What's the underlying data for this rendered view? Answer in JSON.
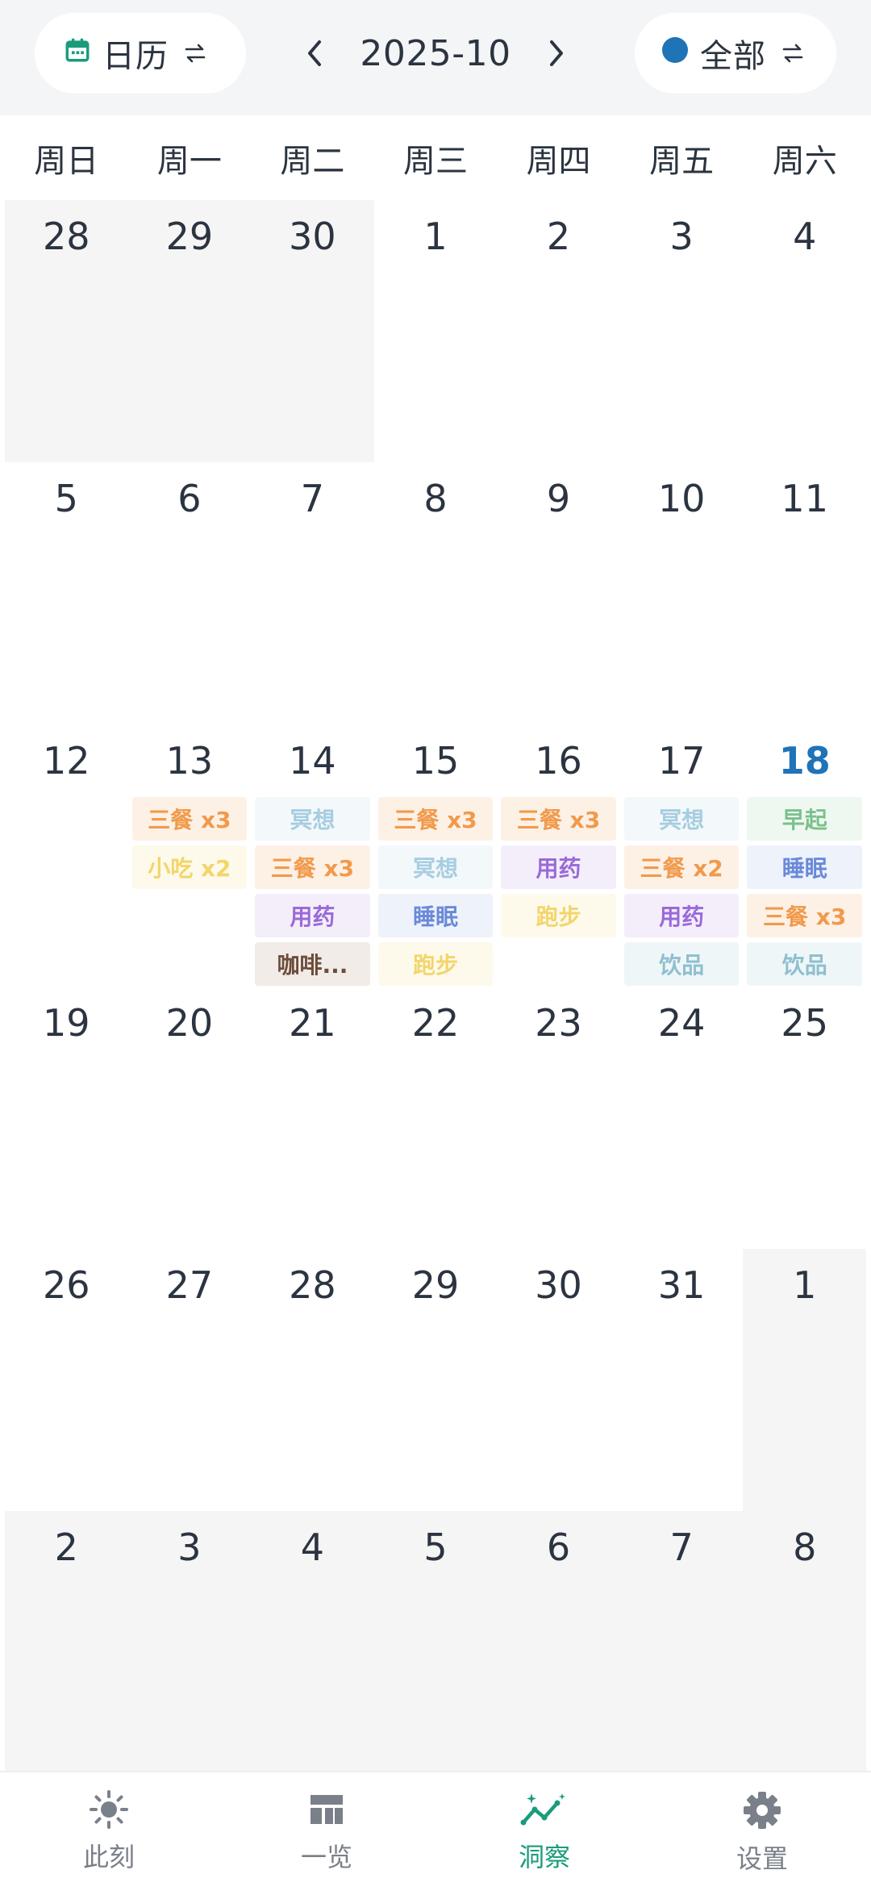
{
  "header": {
    "view_label": "日历",
    "month_label": "2025-10",
    "filter_label": "全部",
    "filter_color": "#1f73b7",
    "view_icon_color": "#1a9c7b"
  },
  "weekdays": [
    "周日",
    "周一",
    "周二",
    "周三",
    "周四",
    "周五",
    "周六"
  ],
  "weeks": [
    [
      {
        "day": "28",
        "out": true
      },
      {
        "day": "29",
        "out": true
      },
      {
        "day": "30",
        "out": true
      },
      {
        "day": "1"
      },
      {
        "day": "2"
      },
      {
        "day": "3"
      },
      {
        "day": "4"
      }
    ],
    [
      {
        "day": "5"
      },
      {
        "day": "6"
      },
      {
        "day": "7"
      },
      {
        "day": "8"
      },
      {
        "day": "9"
      },
      {
        "day": "10"
      },
      {
        "day": "11"
      }
    ],
    [
      {
        "day": "12"
      },
      {
        "day": "13",
        "tags": [
          {
            "text": "三餐 x3",
            "color": "#f19a4c",
            "bg": "#fdf1e6"
          },
          {
            "text": "小吃 x2",
            "color": "#f3d56b",
            "bg": "#fdfaeb"
          }
        ]
      },
      {
        "day": "14",
        "tags": [
          {
            "text": "冥想",
            "color": "#a6cde0",
            "bg": "#f3f8fb"
          },
          {
            "text": "三餐 x3",
            "color": "#f19a4c",
            "bg": "#fdf1e6"
          },
          {
            "text": "用药",
            "color": "#9a6ad8",
            "bg": "#f4eefb"
          },
          {
            "text": "咖啡...",
            "color": "#6d4c3a",
            "bg": "#f1ece8"
          }
        ]
      },
      {
        "day": "15",
        "tags": [
          {
            "text": "三餐 x3",
            "color": "#f19a4c",
            "bg": "#fdf1e6"
          },
          {
            "text": "冥想",
            "color": "#a6cde0",
            "bg": "#f3f8fb"
          },
          {
            "text": "睡眠",
            "color": "#6a8ad8",
            "bg": "#eef2fb"
          },
          {
            "text": "跑步",
            "color": "#f3d56b",
            "bg": "#fdfaeb"
          }
        ]
      },
      {
        "day": "16",
        "tags": [
          {
            "text": "三餐 x3",
            "color": "#f19a4c",
            "bg": "#fdf1e6"
          },
          {
            "text": "用药",
            "color": "#9a6ad8",
            "bg": "#f4eefb"
          },
          {
            "text": "跑步",
            "color": "#f3d56b",
            "bg": "#fdfaeb"
          }
        ]
      },
      {
        "day": "17",
        "tags": [
          {
            "text": "冥想",
            "color": "#a6cde0",
            "bg": "#f3f8fb"
          },
          {
            "text": "三餐 x2",
            "color": "#f19a4c",
            "bg": "#fdf1e6"
          },
          {
            "text": "用药",
            "color": "#9a6ad8",
            "bg": "#f4eefb"
          },
          {
            "text": "饮品",
            "color": "#8fbfcf",
            "bg": "#eff6f8"
          }
        ]
      },
      {
        "day": "18",
        "today": true,
        "tags": [
          {
            "text": "早起",
            "color": "#7cc08c",
            "bg": "#eef8f0"
          },
          {
            "text": "睡眠",
            "color": "#6a8ad8",
            "bg": "#eef2fb"
          },
          {
            "text": "三餐 x3",
            "color": "#f19a4c",
            "bg": "#fdf1e6"
          },
          {
            "text": "饮品",
            "color": "#8fbfcf",
            "bg": "#eff6f8"
          }
        ]
      }
    ],
    [
      {
        "day": "19"
      },
      {
        "day": "20"
      },
      {
        "day": "21"
      },
      {
        "day": "22"
      },
      {
        "day": "23"
      },
      {
        "day": "24"
      },
      {
        "day": "25"
      }
    ],
    [
      {
        "day": "26"
      },
      {
        "day": "27"
      },
      {
        "day": "28"
      },
      {
        "day": "29"
      },
      {
        "day": "30"
      },
      {
        "day": "31"
      },
      {
        "day": "1",
        "out": true
      }
    ],
    [
      {
        "day": "2",
        "out": true
      },
      {
        "day": "3",
        "out": true
      },
      {
        "day": "4",
        "out": true
      },
      {
        "day": "5",
        "out": true
      },
      {
        "day": "6",
        "out": true
      },
      {
        "day": "7",
        "out": true
      },
      {
        "day": "8",
        "out": true
      }
    ]
  ],
  "bottom_nav": [
    {
      "label": "此刻",
      "icon": "sun-icon",
      "active": false
    },
    {
      "label": "一览",
      "icon": "dashboard-icon",
      "active": false
    },
    {
      "label": "洞察",
      "icon": "insight-chart-icon",
      "active": true
    },
    {
      "label": "设置",
      "icon": "gear-icon",
      "active": false
    }
  ],
  "colors": {
    "active": "#1a9c7b",
    "inactive": "#7a8089",
    "text": "#2b3440"
  }
}
